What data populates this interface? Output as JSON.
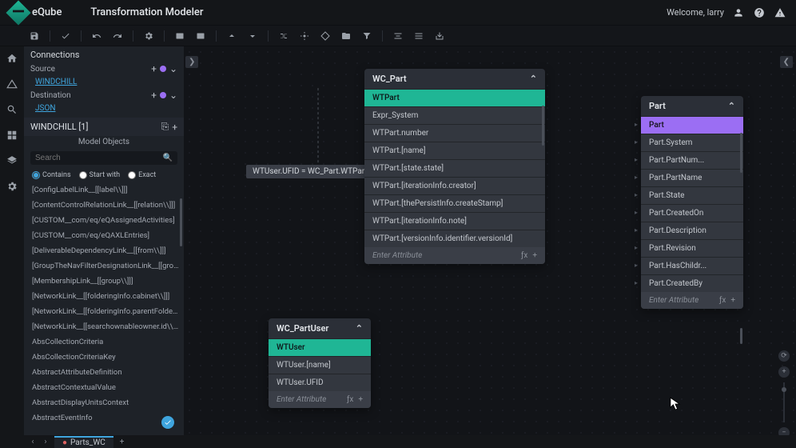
{
  "brand": "eQube",
  "app_title": "Transformation Modeler",
  "welcome": "Welcome, larry",
  "sidebar": {
    "connections_label": "Connections",
    "source_label": "Source",
    "source_value": "WINDCHILL",
    "destination_label": "Destination",
    "destination_value": "JSON",
    "tree_title": "WINDCHILL [1]",
    "model_objects_label": "Model Objects",
    "search_placeholder": "Search",
    "filters": {
      "contains": "Contains",
      "start_with": "Start with",
      "exact": "Exact"
    },
    "items": [
      "[ConfigLabelLink__[[label\\\\]]]",
      "[ContentControlRelationLink__[[relation\\\\]]]",
      "[CUSTOM__com/eq/eQAssignedActivities]",
      "[CUSTOM__com/eq/eQAXLEntries]",
      "[DeliverableDependencyLink__[[from\\\\]]]",
      "[GroupTheNavFilterDesignationLink__[[group\\\\]]]",
      "[MembershipLink__[[group\\\\]]]",
      "[NetworkLink__[[folderingInfo.cabinet\\\\]]]",
      "[NetworkLink__[[folderingInfo.parentFolder\\\\]]]",
      "[NetworkLink__[[searchownableowner.id\\\\]]]",
      "AbsCollectionCriteria",
      "AbsCollectionCriteriaKey",
      "AbstractAttributeDefinition",
      "AbstractContextualValue",
      "AbstractDisplayUnitsContext",
      "AbstractEventInfo"
    ]
  },
  "tooltip_text": "WTUser.UFID  =  WC_Part.WTPart.[iterati",
  "nodes": {
    "wc_part": {
      "title": "WC_Part",
      "rows": [
        "WTPart",
        "Expr_System",
        "WTPart.number",
        "WTPart.[name]",
        "WTPart.[state.state]",
        "WTPart.[iterationInfo.creator]",
        "WTPart.[thePersistInfo.createStamp]",
        "WTPart.[iterationInfo.note]",
        "WTPart.[versionInfo.identifier.versionId]"
      ],
      "footer": "Enter Attribute"
    },
    "wc_partuser": {
      "title": "WC_PartUser",
      "rows": [
        "WTUser",
        "WTUser.[name]",
        "WTUser.UFID"
      ],
      "footer": "Enter Attribute"
    },
    "part": {
      "title": "Part",
      "rows": [
        "Part",
        "Part.System",
        "Part.PartNum...",
        "Part.PartName",
        "Part.State",
        "Part.CreatedOn",
        "Part.Description",
        "Part.Revision",
        "Part.HasChildr...",
        "Part.CreatedBy"
      ],
      "footer": "Enter Attribute"
    }
  },
  "tabs": {
    "active": "Parts_WC"
  }
}
